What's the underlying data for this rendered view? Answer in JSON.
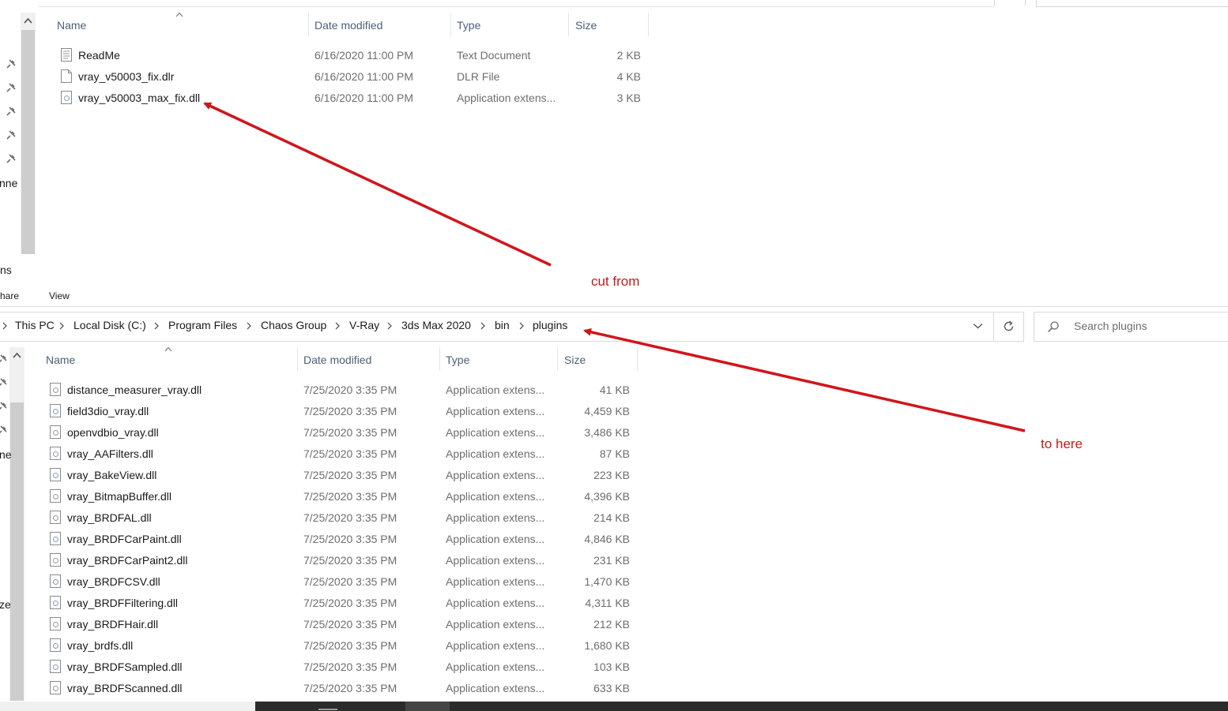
{
  "top_pane": {
    "columns": {
      "name": "Name",
      "date": "Date modified",
      "type": "Type",
      "size": "Size"
    },
    "rows": [
      {
        "name": "ReadMe",
        "date": "6/16/2020 11:00 PM",
        "type": "Text Document",
        "size": "2 KB",
        "icon": "text-file-icon"
      },
      {
        "name": "vray_v50003_fix.dlr",
        "date": "6/16/2020 11:00 PM",
        "type": "DLR File",
        "size": "4 KB",
        "icon": "blank-file-icon"
      },
      {
        "name": "vray_v50003_max_fix.dll",
        "date": "6/16/2020 11:00 PM",
        "type": "Application extens...",
        "size": "3 KB",
        "icon": "dll-file-icon"
      }
    ],
    "left_fragments": {
      "nne": "nne",
      "ns": "ns"
    }
  },
  "ribbon": {
    "share": "hare",
    "view": "View"
  },
  "address_bar": {
    "crumbs": [
      "This PC",
      "Local Disk (C:)",
      "Program Files",
      "Chaos Group",
      "V-Ray",
      "3ds Max 2020",
      "bin",
      "plugins"
    ],
    "search_placeholder": "Search plugins"
  },
  "bottom_pane": {
    "columns": {
      "name": "Name",
      "date": "Date modified",
      "type": "Type",
      "size": "Size"
    },
    "rows": [
      {
        "name": "distance_measurer_vray.dll",
        "date": "7/25/2020 3:35 PM",
        "type": "Application extens...",
        "size": "41 KB"
      },
      {
        "name": "field3dio_vray.dll",
        "date": "7/25/2020 3:35 PM",
        "type": "Application extens...",
        "size": "4,459 KB"
      },
      {
        "name": "openvdbio_vray.dll",
        "date": "7/25/2020 3:35 PM",
        "type": "Application extens...",
        "size": "3,486 KB"
      },
      {
        "name": "vray_AAFilters.dll",
        "date": "7/25/2020 3:35 PM",
        "type": "Application extens...",
        "size": "87 KB"
      },
      {
        "name": "vray_BakeView.dll",
        "date": "7/25/2020 3:35 PM",
        "type": "Application extens...",
        "size": "223 KB"
      },
      {
        "name": "vray_BitmapBuffer.dll",
        "date": "7/25/2020 3:35 PM",
        "type": "Application extens...",
        "size": "4,396 KB"
      },
      {
        "name": "vray_BRDFAL.dll",
        "date": "7/25/2020 3:35 PM",
        "type": "Application extens...",
        "size": "214 KB"
      },
      {
        "name": "vray_BRDFCarPaint.dll",
        "date": "7/25/2020 3:35 PM",
        "type": "Application extens...",
        "size": "4,846 KB"
      },
      {
        "name": "vray_BRDFCarPaint2.dll",
        "date": "7/25/2020 3:35 PM",
        "type": "Application extens...",
        "size": "231 KB"
      },
      {
        "name": "vray_BRDFCSV.dll",
        "date": "7/25/2020 3:35 PM",
        "type": "Application extens...",
        "size": "1,470 KB"
      },
      {
        "name": "vray_BRDFFiltering.dll",
        "date": "7/25/2020 3:35 PM",
        "type": "Application extens...",
        "size": "4,311 KB"
      },
      {
        "name": "vray_BRDFHair.dll",
        "date": "7/25/2020 3:35 PM",
        "type": "Application extens...",
        "size": "212 KB"
      },
      {
        "name": "vray_brdfs.dll",
        "date": "7/25/2020 3:35 PM",
        "type": "Application extens...",
        "size": "1,680 KB"
      },
      {
        "name": "vray_BRDFSampled.dll",
        "date": "7/25/2020 3:35 PM",
        "type": "Application extens...",
        "size": "103 KB"
      },
      {
        "name": "vray_BRDFScanned.dll",
        "date": "7/25/2020 3:35 PM",
        "type": "Application extens...",
        "size": "633 KB"
      }
    ],
    "left_fragments": {
      "ne": "ne",
      "ze": "ze"
    }
  },
  "annotations": {
    "cut_from": "cut from",
    "to_here": "to here"
  },
  "colors": {
    "annotation_red": "#d0151b",
    "header_text": "#4c607a",
    "muted_text": "#6d6d6d",
    "scrollbar": "#cdcdcd",
    "taskbar": "#2b2b2b"
  }
}
